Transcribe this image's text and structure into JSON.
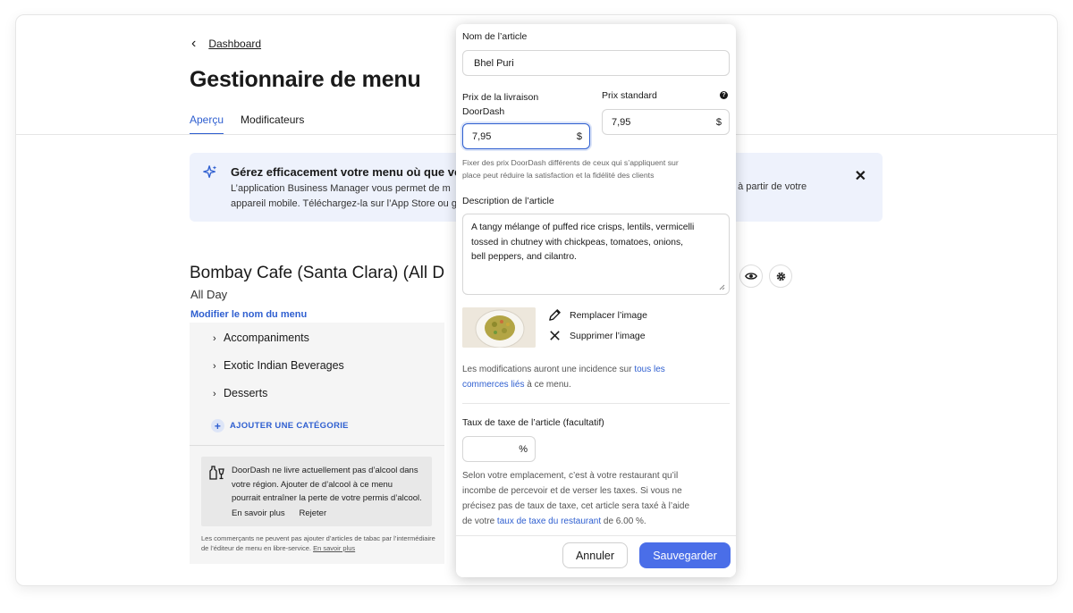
{
  "page": {
    "back_label": "Dashboard",
    "title": "Gestionnaire de menu",
    "tabs": [
      {
        "label": "Aperçu"
      },
      {
        "label": "Modificateurs"
      }
    ]
  },
  "banner": {
    "title": "Gérez efficacement votre menu où que vou",
    "body_line1": "L’application Business Manager vous permet de m",
    "body_line1_right": "t à partir de votre",
    "body_line2": "appareil mobile. Téléchargez-la sur l’App Store ou g"
  },
  "menu": {
    "store_name": "Bombay Cafe (Santa Clara) (All D",
    "daypart": "All Day",
    "rename_link": "Modifier le nom du menu",
    "categories": [
      {
        "label": "Accompaniments"
      },
      {
        "label": "Exotic Indian Beverages"
      },
      {
        "label": "Desserts"
      }
    ],
    "add_category": "AJOUTER UNE CATÉGORIE",
    "alcohol_notice": "DoorDash ne livre actuellement pas d’alcool dans votre région. Ajouter de d’alcool à ce menu pourrait entraîner la perte de votre permis d’alcool.",
    "alcohol_links": "En savoir plus      Rejeter",
    "tobacco_notice": "Les commerçants ne peuvent pas ajouter d’articles de tabac par l’intermédiaire de l’éditeur de menu en libre-service.",
    "tobacco_link": "En savoir plus"
  },
  "modal": {
    "name_label": "Nom de l’article",
    "name_value": "Bhel Puri",
    "delivery_price_label_1": "Prix de la livraison",
    "delivery_price_label_2": "DoorDash",
    "delivery_price_value": "7,95",
    "standard_price_label": "Prix standard",
    "standard_price_value": "7,95",
    "currency": "$",
    "price_help_1": "Fixer des prix DoorDash différents de ceux qui s’appliquent sur",
    "price_help_2": "place peut réduire la satisfaction et la fidélité des clients",
    "description_label": "Description de l’article",
    "description_line1": "A tangy mélange of puffed rice crisps, lentils, vermicelli",
    "description_line2": "tossed in chutney with chickpeas, tomatoes, onions,",
    "description_line3": "bell peppers, and cilantro.",
    "replace_image": "Remplacer l’image",
    "delete_image": "Supprimer l’image",
    "linked_1a": "Les modifications auront une incidence sur ",
    "linked_1b": "tous les",
    "linked_2a": "commerces liés",
    "linked_2b": " à ce menu.",
    "tax_label": "Taux de taxe de l’article (facultatif)",
    "tax_value": "",
    "percent": "%",
    "tax_help_1": "Selon votre emplacement, c’est à votre restaurant qu’il",
    "tax_help_2": "incombe de percevoir et de verser les taxes. Si vous ne",
    "tax_help_3": "précisez pas de taux de taxe, cet article sera taxé à l’aide",
    "tax_help_4a": "de votre ",
    "tax_help_4b": "taux de taxe du restaurant",
    "tax_help_4c": " de 6.00 %.",
    "cancel_label": "Annuler",
    "save_label": "Sauvegarder"
  },
  "colors": {
    "accent": "#2f5fd0",
    "save_button": "#4a6ee8",
    "banner_bg": "#eef2fc"
  }
}
